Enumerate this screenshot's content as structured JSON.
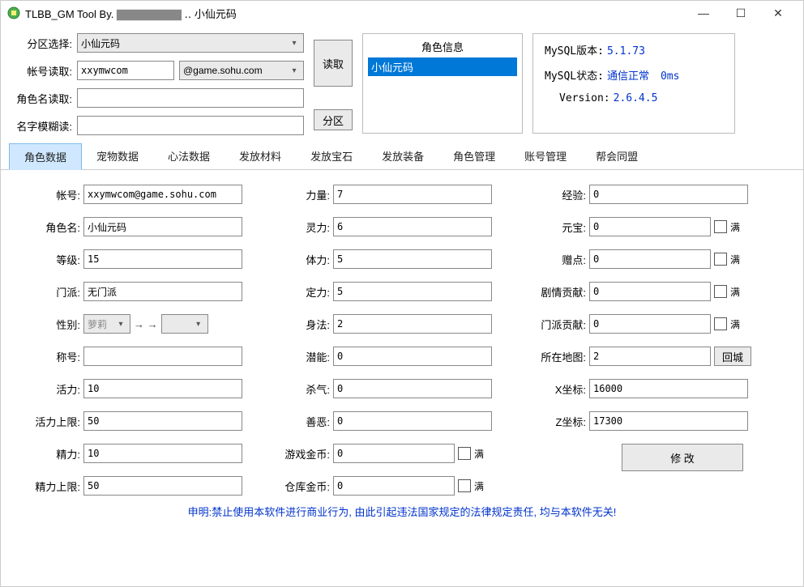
{
  "window": {
    "title_prefix": "TLBB_GM Tool By. ",
    "title_mid_masked": "▇▇▇▇▇▇▇▇",
    "title_suffix": " ‥ 小仙元码"
  },
  "top": {
    "partition_label": "分区选择:",
    "partition_value": "小仙元码",
    "account_label": "帐号读取:",
    "account_value": "xxymwcom",
    "account_domain": "@game.sohu.com",
    "rolename_label": "角色名读取:",
    "rolename_value": "",
    "fuzzy_label": "名字模糊读:",
    "fuzzy_value": "",
    "btn_read": "读取",
    "btn_partition": "分区"
  },
  "rolebox": {
    "header": "角色信息",
    "selected": "小仙元码"
  },
  "status": {
    "mysql_version_label": "MySQL版本:",
    "mysql_version_value": "5.1.73",
    "mysql_state_label": "MySQL状态:",
    "mysql_state_value": "通信正常",
    "mysql_state_ms": "0ms",
    "version_label": "Version:",
    "version_value": "2.6.4.5"
  },
  "tabs": [
    "角色数据",
    "宠物数据",
    "心法数据",
    "发放材料",
    "发放宝石",
    "发放装备",
    "角色管理",
    "账号管理",
    "帮会同盟"
  ],
  "fields_left": {
    "account": {
      "label": "帐号:",
      "value": "xxymwcom@game.sohu.com"
    },
    "rolename": {
      "label": "角色名:",
      "value": "小仙元码"
    },
    "level": {
      "label": "等级:",
      "value": "15"
    },
    "faction": {
      "label": "门派:",
      "value": "无门派"
    },
    "gender": {
      "label": "性别:",
      "value": "萝莉",
      "arrow": "→ →"
    },
    "title": {
      "label": "称号:",
      "value": ""
    },
    "energy": {
      "label": "活力:",
      "value": "10"
    },
    "energy_max": {
      "label": "活力上限:",
      "value": "50"
    },
    "spirit": {
      "label": "精力:",
      "value": "10"
    },
    "spirit_max": {
      "label": "精力上限:",
      "value": "50"
    }
  },
  "fields_mid": {
    "str": {
      "label": "力量:",
      "value": "7"
    },
    "int": {
      "label": "灵力:",
      "value": "6"
    },
    "con": {
      "label": "体力:",
      "value": "5"
    },
    "wil": {
      "label": "定力:",
      "value": "5"
    },
    "dex": {
      "label": "身法:",
      "value": "2"
    },
    "potential": {
      "label": "潜能:",
      "value": "0"
    },
    "sha": {
      "label": "杀气:",
      "value": "0"
    },
    "good": {
      "label": "善恶:",
      "value": "0"
    },
    "gold": {
      "label": "游戏金币:",
      "value": "0",
      "max_label": "满"
    },
    "bankgold": {
      "label": "仓库金币:",
      "value": "0",
      "max_label": "满"
    }
  },
  "fields_right": {
    "exp": {
      "label": "经验:",
      "value": "0"
    },
    "yuanbao": {
      "label": "元宝:",
      "value": "0",
      "max_label": "满"
    },
    "gift": {
      "label": "赠点:",
      "value": "0",
      "max_label": "满"
    },
    "story": {
      "label": "剧情贡献:",
      "value": "0",
      "max_label": "满"
    },
    "faction_contrib": {
      "label": "门派贡献:",
      "value": "0",
      "max_label": "满"
    },
    "map": {
      "label": "所在地图:",
      "value": "2",
      "btn": "回城"
    },
    "x": {
      "label": "X坐标:",
      "value": "16000"
    },
    "z": {
      "label": "Z坐标:",
      "value": "17300"
    },
    "modify_btn": "修 改"
  },
  "disclaimer": "申明:禁止使用本软件进行商业行为, 由此引起违法国家规定的法律规定责任, 均与本软件无关!"
}
